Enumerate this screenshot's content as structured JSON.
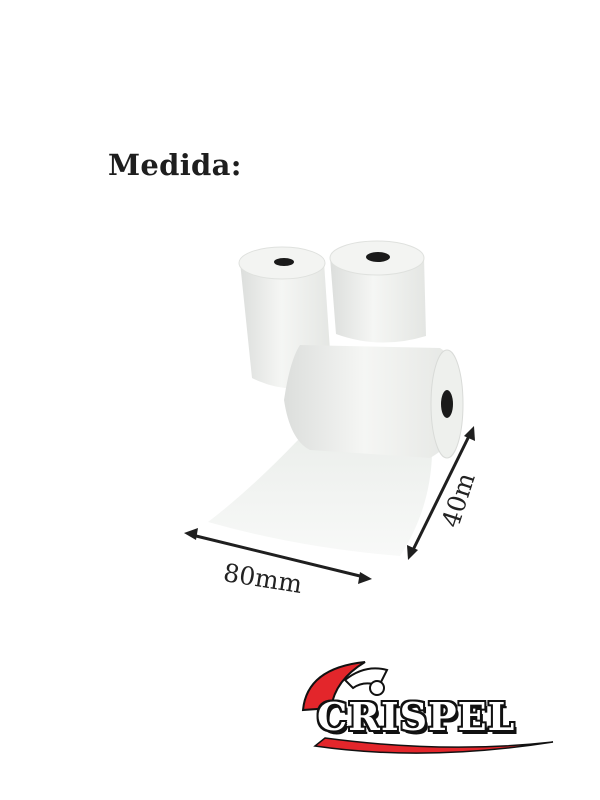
{
  "heading": "Medida:",
  "dimensions": {
    "width_label": "80mm",
    "length_label": "40m"
  },
  "logo": {
    "brand_text": "CRISPEL",
    "colors": {
      "swoosh": "#e3262b",
      "outline": "#111111"
    }
  },
  "product": {
    "icon": "paper-roll-icon",
    "count": 3,
    "color": "#f2f3f1"
  }
}
